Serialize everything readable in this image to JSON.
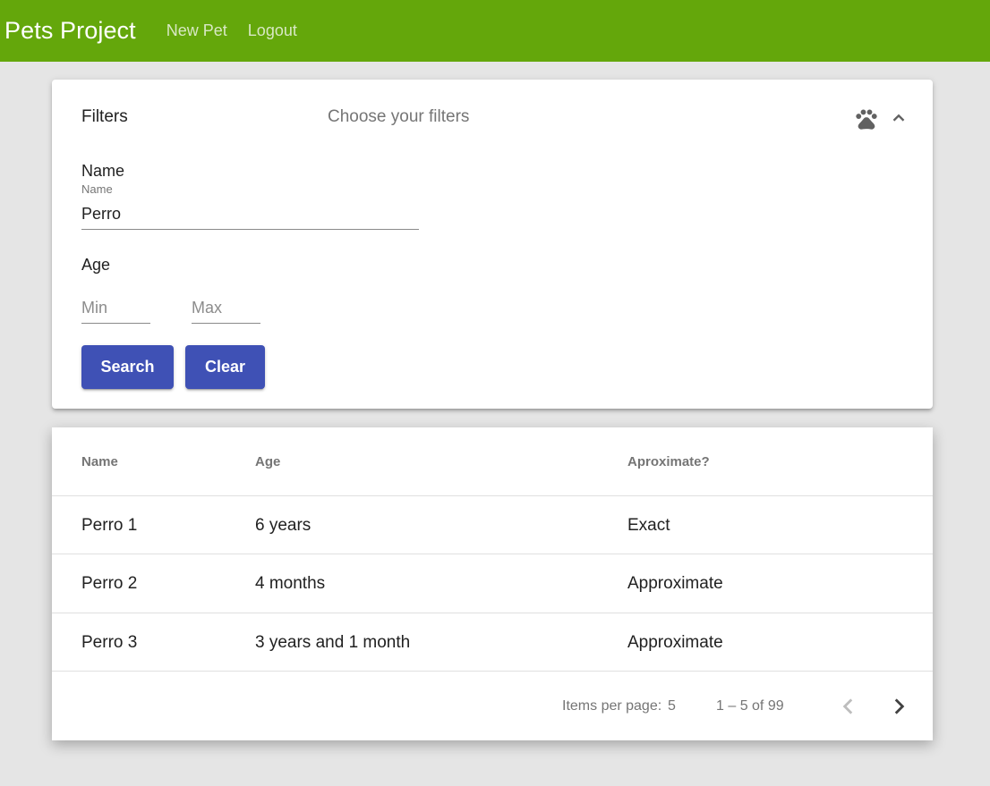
{
  "app": {
    "title": "Pets Project",
    "nav": [
      "New Pet",
      "Logout"
    ]
  },
  "filters": {
    "title": "Filters",
    "description": "Choose your filters",
    "name_section": "Name",
    "name_field": {
      "label": "Name",
      "value": "Perro"
    },
    "age_section": "Age",
    "min_placeholder": "Min",
    "max_placeholder": "Max",
    "search_label": "Search",
    "clear_label": "Clear"
  },
  "table": {
    "headers": [
      "Name",
      "Age",
      "Aproximate?"
    ],
    "rows": [
      [
        "Perro 1",
        "6 years",
        "Exact"
      ],
      [
        "Perro 2",
        "4 months",
        "Approximate"
      ],
      [
        "Perro 3",
        "3 years and 1 month",
        "Approximate"
      ]
    ]
  },
  "paginator": {
    "items_per_page_label": "Items per page:",
    "items_per_page": "5",
    "range": "1 – 5 of 99"
  },
  "colors": {
    "toolbar": "#64a70b",
    "primary_button": "#3f51b5"
  },
  "icons": [
    "paw-icon",
    "chevron-up-icon",
    "chevron-left-icon",
    "chevron-right-icon"
  ]
}
